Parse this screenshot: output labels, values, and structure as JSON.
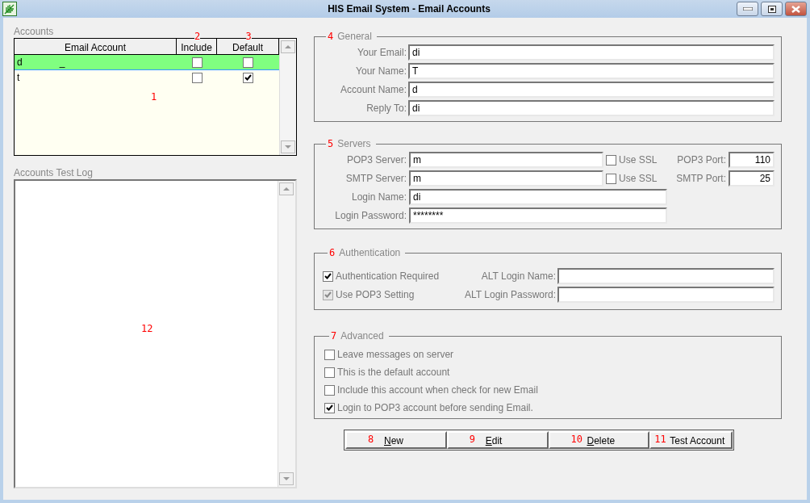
{
  "window": {
    "title": "HIS Email System - Email Accounts"
  },
  "accounts": {
    "label": "Accounts",
    "marker": "1",
    "columns": [
      {
        "label": "Email Account"
      },
      {
        "label": "Include",
        "marker": "2"
      },
      {
        "label": "Default",
        "marker": "3"
      }
    ],
    "rows": [
      {
        "email": "d",
        "extra": "_",
        "include": false,
        "default": false,
        "selected": true
      },
      {
        "email": "t",
        "include": false,
        "default": true,
        "selected": false
      }
    ]
  },
  "test_log": {
    "label": "Accounts Test Log",
    "marker": "12"
  },
  "general": {
    "title": "General",
    "marker": "4",
    "fields": [
      {
        "label": "Your Email:",
        "value": "di"
      },
      {
        "label": "Your Name:",
        "value": "T"
      },
      {
        "label": "Account Name:",
        "value": "d"
      },
      {
        "label": "Reply To:",
        "value": "di"
      }
    ]
  },
  "servers": {
    "title": "Servers",
    "marker": "5",
    "servers": [
      {
        "label": "POP3 Server:",
        "value": "m",
        "ssl_label": "Use SSL",
        "ssl": false,
        "port_label": "POP3 Port:",
        "port": "110"
      },
      {
        "label": "SMTP Server:",
        "value": "m",
        "ssl_label": "Use SSL",
        "ssl": false,
        "port_label": "SMTP Port:",
        "port": "25"
      }
    ],
    "login": [
      {
        "label": "Login Name:",
        "value": "di"
      },
      {
        "label": "Login Password:",
        "value": "********"
      }
    ]
  },
  "authentication": {
    "title": "Authentication",
    "marker": "6",
    "checks": [
      {
        "label": "Authentication Required",
        "checked": true,
        "disabled": false
      },
      {
        "label": "Use POP3 Setting",
        "checked": true,
        "disabled": true
      }
    ],
    "fields": [
      {
        "label": "ALT Login Name:"
      },
      {
        "label": "ALT Login Password:"
      }
    ]
  },
  "advanced": {
    "title": "Advanced",
    "marker": "7",
    "checks": [
      {
        "label": "Leave messages on server",
        "checked": false
      },
      {
        "label": "This is the default account",
        "checked": false
      },
      {
        "label": "Include this account when check for new Email",
        "checked": false
      },
      {
        "label": "Login to POP3 account before sending Email.",
        "checked": true
      }
    ]
  },
  "buttons": [
    {
      "label": "New",
      "marker": "8",
      "mnemonic": true
    },
    {
      "label": "Edit",
      "marker": "9",
      "mnemonic": true
    },
    {
      "label": "Delete",
      "marker": "10",
      "mnemonic": true
    },
    {
      "label": "Test Account",
      "marker": "11",
      "mnemonic": false
    }
  ]
}
